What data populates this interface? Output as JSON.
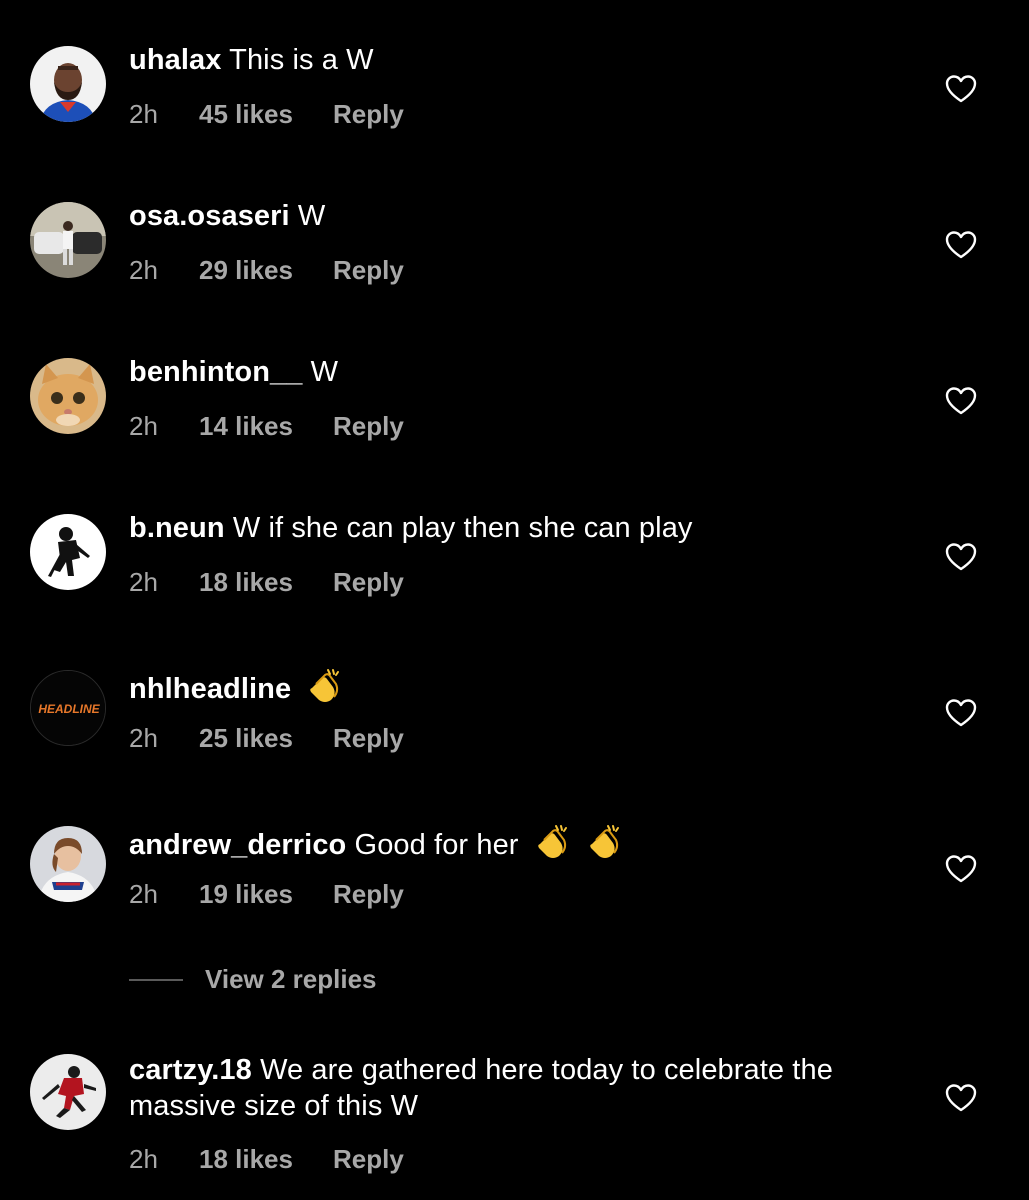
{
  "colors": {
    "background": "#000000",
    "primary_text": "#ffffff",
    "secondary_text": "#a8a8a8",
    "divider": "#5a5a5a"
  },
  "comments": [
    {
      "username": "uhalax",
      "text": "This is a W",
      "time": "2h",
      "likes": "45 likes",
      "reply": "Reply",
      "avatar": "player-portrait-avatar",
      "emoji": []
    },
    {
      "username": "osa.osaseri",
      "text": "W",
      "time": "2h",
      "likes": "29 likes",
      "reply": "Reply",
      "avatar": "person-with-car-avatar",
      "emoji": []
    },
    {
      "username": "benhinton__",
      "text": "W",
      "time": "2h",
      "likes": "14 likes",
      "reply": "Reply",
      "avatar": "cat-avatar",
      "emoji": []
    },
    {
      "username": "b.neun",
      "text": "W if she can play then she can play",
      "time": "2h",
      "likes": "18 likes",
      "reply": "Reply",
      "avatar": "hockey-player-silhouette-avatar",
      "emoji": []
    },
    {
      "username": "nhlheadline",
      "text": "",
      "time": "2h",
      "likes": "25 likes",
      "reply": "Reply",
      "avatar": "headline-logo-avatar",
      "avatar_text": "HEADLINE",
      "emoji": [
        "clapping-hands-emoji"
      ]
    },
    {
      "username": "andrew_derrico",
      "text": "Good for her",
      "time": "2h",
      "likes": "19 likes",
      "reply": "Reply",
      "avatar": "rangers-player-avatar",
      "emoji": [
        "clapping-hands-emoji",
        "clapping-hands-emoji"
      ]
    },
    {
      "username": "cartzy.18",
      "text": "We are gathered here today to celebrate the massive size of this W",
      "time": "2h",
      "likes": "18 likes",
      "reply": "Reply",
      "avatar": "skating-player-avatar",
      "emoji": []
    }
  ],
  "view_replies": "View 2 replies",
  "icons": {
    "like": "heart-outline-icon"
  }
}
